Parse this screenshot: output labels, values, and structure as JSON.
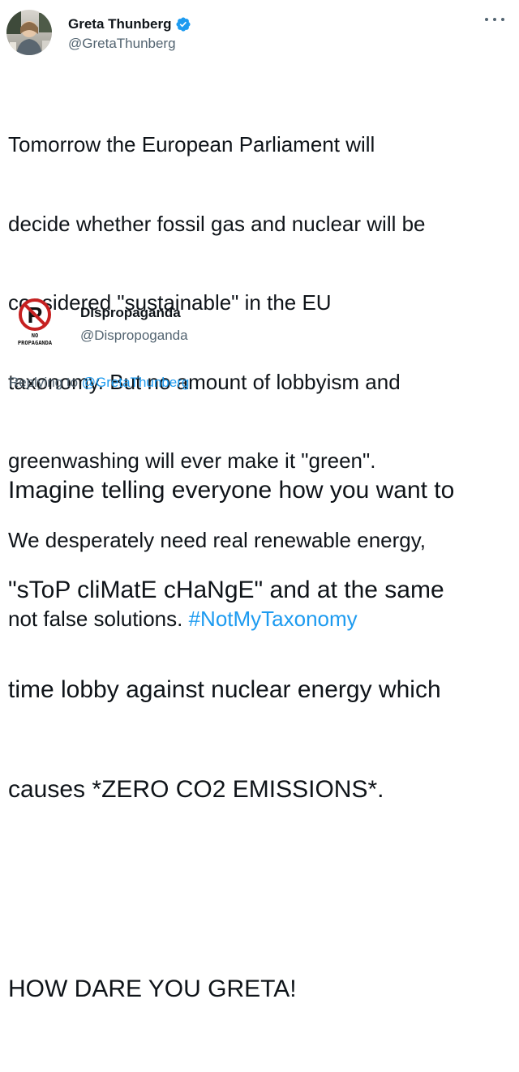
{
  "original_tweet": {
    "author_name": "Greta Thunberg",
    "author_handle": "@GretaThunberg",
    "verified": true,
    "text_lines": [
      "Tomorrow the European Parliament will",
      "decide whether fossil gas and nuclear will be",
      "considered \"sustainable\" in the EU",
      "taxonomy. But no amount of lobbyism and",
      "greenwashing will ever make it \"green\".",
      "We desperately need real renewable energy,",
      "not false solutions. "
    ],
    "hashtag": "#NotMyTaxonomy"
  },
  "reply_tweet": {
    "author_name": "Dispropaganda",
    "author_handle": "@Dispropoganda",
    "avatar_letter": "P",
    "avatar_caption_top": "NO",
    "avatar_caption_bottom": "PROPAGANDA",
    "replying_to_prefix": "Replying to ",
    "replying_to_handle": "@GretaThunberg",
    "text_lines": [
      "Imagine telling everyone how you want to",
      "\"sToP cliMatE cHaNgE\" and at the same",
      "time lobby against nuclear energy which",
      "causes *ZERO CO2 EMISSIONS*.",
      "",
      "HOW DARE YOU GRETA!"
    ]
  },
  "colors": {
    "link": "#1d9bf0",
    "secondary_text": "#536471",
    "primary_text": "#0f1419",
    "verified_badge": "#1d9bf0"
  },
  "icons": {
    "more": "more-horizontal-icon",
    "verified": "verified-badge-icon",
    "no_propaganda": "no-symbol-icon"
  }
}
